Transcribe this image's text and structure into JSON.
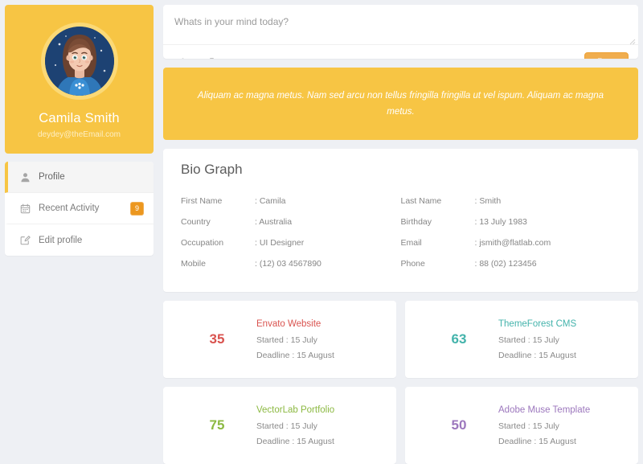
{
  "sidebar": {
    "profile": {
      "name": "Camila Smith",
      "email": "deydey@theEmail.com",
      "avatar_icon": "user-avatar-illustration"
    },
    "menu": [
      {
        "label": "Profile",
        "icon": "user-icon",
        "badge": null,
        "active": true
      },
      {
        "label": "Recent Activity",
        "icon": "calendar-icon",
        "badge": "9",
        "active": false
      },
      {
        "label": "Edit profile",
        "icon": "edit-pencil-icon",
        "badge": null,
        "active": false
      }
    ]
  },
  "post_box": {
    "placeholder": "Whats in your mind today?",
    "value": "",
    "tools": [
      {
        "icon": "map-marker-icon",
        "name": "location"
      },
      {
        "icon": "camera-icon",
        "name": "photo"
      },
      {
        "icon": "film-icon",
        "name": "video"
      },
      {
        "icon": "microphone-icon",
        "name": "audio"
      }
    ],
    "submit_label": "Post"
  },
  "quote": {
    "text": "Aliquam ac magna metus. Nam sed arcu non tellus fringilla fringilla ut vel ispum. Aliquam ac magna metus."
  },
  "bio": {
    "title": "Bio Graph",
    "left": [
      {
        "label": "First Name",
        "value": ": Camila"
      },
      {
        "label": "Country",
        "value": ": Australia"
      },
      {
        "label": "Occupation",
        "value": ": UI Designer"
      },
      {
        "label": "Mobile",
        "value": ": (12) 03 4567890"
      }
    ],
    "right": [
      {
        "label": "Last Name",
        "value": ": Smith"
      },
      {
        "label": "Birthday",
        "value": ": 13 July 1983"
      },
      {
        "label": "Email",
        "value": ": jsmith@flatlab.com"
      },
      {
        "label": "Phone",
        "value": ": 88 (02) 123456"
      }
    ]
  },
  "projects": [
    {
      "number": "35",
      "title": "Envato Website",
      "started": "Started : 15 July",
      "deadline": "Deadline : 15 August",
      "color": "#d9534f"
    },
    {
      "number": "63",
      "title": "ThemeForest CMS",
      "started": "Started : 15 July",
      "deadline": "Deadline : 15 August",
      "color": "#43b3ab"
    },
    {
      "number": "75",
      "title": "VectorLab Portfolio",
      "started": "Started : 15 July",
      "deadline": "Deadline : 15 August",
      "color": "#8cb942"
    },
    {
      "number": "50",
      "title": "Adobe Muse Template",
      "started": "Started : 15 July",
      "deadline": "Deadline : 15 August",
      "color": "#9c77bd"
    }
  ],
  "theme": {
    "page_bg": "#eef0f4",
    "brand_yellow": "#f7c544",
    "post_orange": "#f0ad4e",
    "badge_orange": "#ec971f"
  }
}
